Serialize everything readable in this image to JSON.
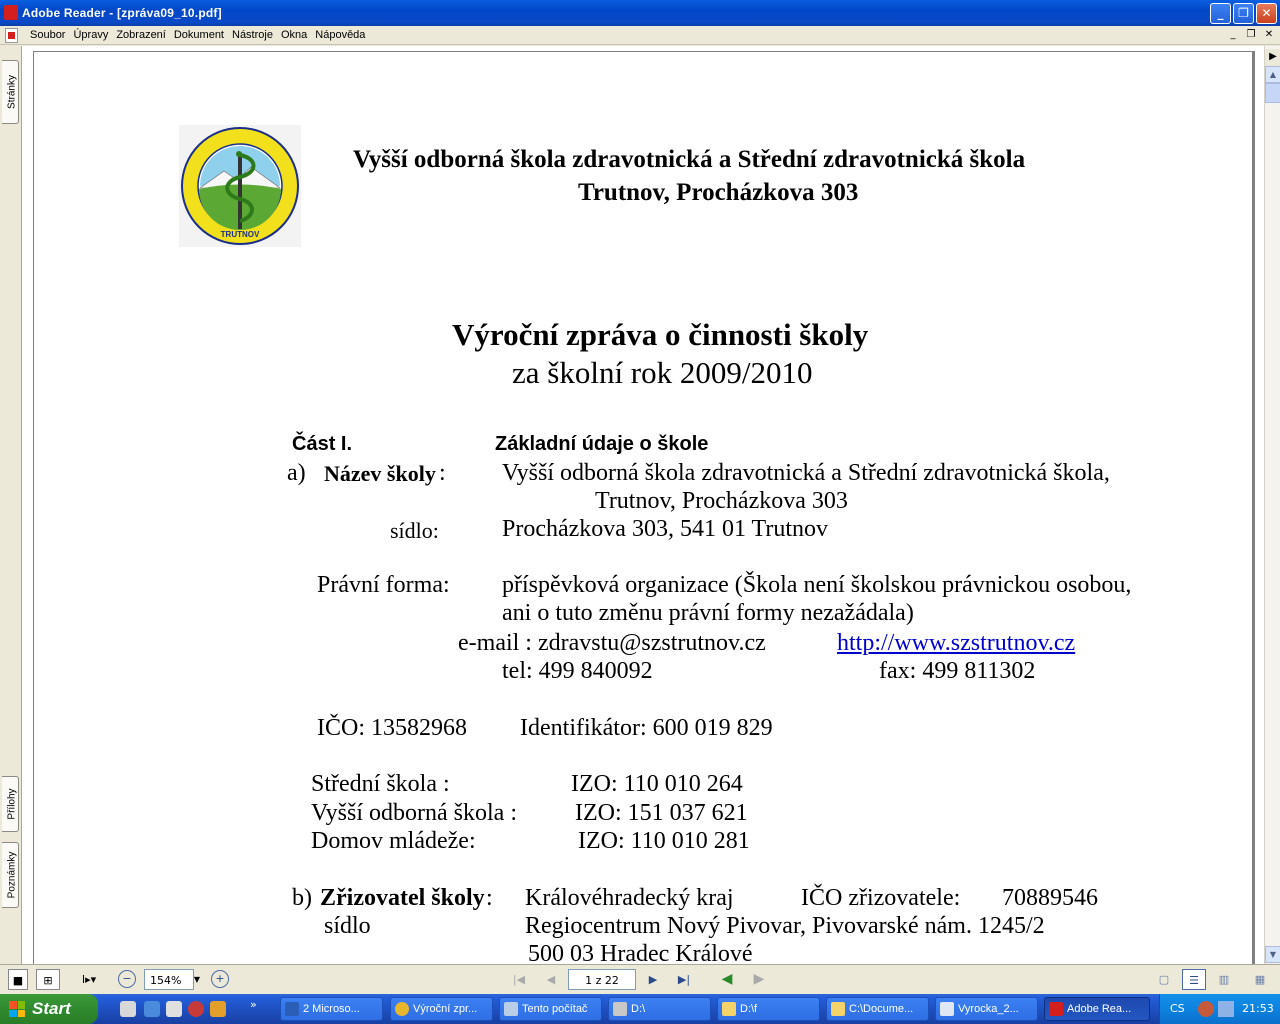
{
  "window": {
    "title": "Adobe Reader - [zpráva09_10.pdf]",
    "minimize": "_",
    "restore": "❐",
    "close": "✕"
  },
  "menu": {
    "items": [
      "Soubor",
      "Úpravy",
      "Zobrazení",
      "Dokument",
      "Nástroje",
      "Okna",
      "Nápověda"
    ],
    "mdi": [
      "_",
      "❐",
      "✕"
    ]
  },
  "side_tabs": {
    "pages": "Stránky",
    "attachments": "Přílohy",
    "comments": "Poznámky"
  },
  "doc": {
    "header_line1": "Vyšší odborná škola zdravotnická a Střední zdravotnická škola",
    "header_line2": "Trutnov, Procházkova 303",
    "logo_text_top": "Vyšší odborná škola zdravotnická a Střední zdravotnická škola",
    "logo_text_bottom": "TRUTNOV",
    "title": "Výroční zpráva o činnosti školy",
    "subtitle": "za školní rok 2009/2010",
    "part_label": "Část I.",
    "part_title": "Základní údaje o škole",
    "a_label": "a)",
    "nazev_label": "Název školy",
    "nazev_colon": ":",
    "nazev_value1": "Vyšší odborná škola zdravotnická a Střední zdravotnická škola,",
    "nazev_value2": "Trutnov, Procházkova 303",
    "sidlo_label": "sídlo:",
    "sidlo_value": "Procházkova 303,  541 01  Trutnov",
    "pravni_label": "Právní forma:",
    "pravni_value1": "příspěvková organizace  (Škola není školskou právnickou osobou,",
    "pravni_value2": "ani o tuto změnu právní formy nezažádala)",
    "email": "e-mail : zdravstu@szstrutnov.cz",
    "web": "http://www.szstrutnov.cz",
    "tel": "tel:    499 840092",
    "fax": "fax:    499 811302",
    "ico": "IČO:  13582968",
    "identifikator": "Identifikátor:  600 019 829",
    "ss_label": "Střední škola :",
    "ss_izo": "IZO:  110 010 264",
    "vos_label": "Vyšší odborná škola :",
    "vos_izo": "IZO:  151 037 621",
    "dm_label": "Domov mládeže:",
    "dm_izo": "IZO:  110 010 281",
    "b_label": "b)",
    "zriz_label": "Zřizovatel školy",
    "zriz_colon": ":",
    "zriz_value": "Královéhradecký kraj",
    "zriz_ico": "IČO zřizovatele:",
    "zriz_ico_value": "70889546",
    "zriz_sidlo": "sídlo",
    "zriz_addr1": "Regiocentrum Nový Pivovar,  Pivovarské nám. 1245/2",
    "zriz_addr2": "500 03  Hradec Králové"
  },
  "statusbar": {
    "zoom": "154%",
    "page": "1 z 22"
  },
  "taskbar": {
    "start": "Start",
    "tasks": [
      "2 Microso...",
      "Výroční zpr...",
      "Tento počítač",
      "D:\\",
      "D:\\f",
      "C:\\Docume...",
      "Vyrocka_2...",
      "Adobe Rea..."
    ],
    "lang": "CS",
    "clock": "21:53"
  },
  "colors": {
    "titlebar": "#0a4fd6",
    "link": "#0000cc",
    "start": "#2f8a2d",
    "taskbar": "#245edb"
  }
}
